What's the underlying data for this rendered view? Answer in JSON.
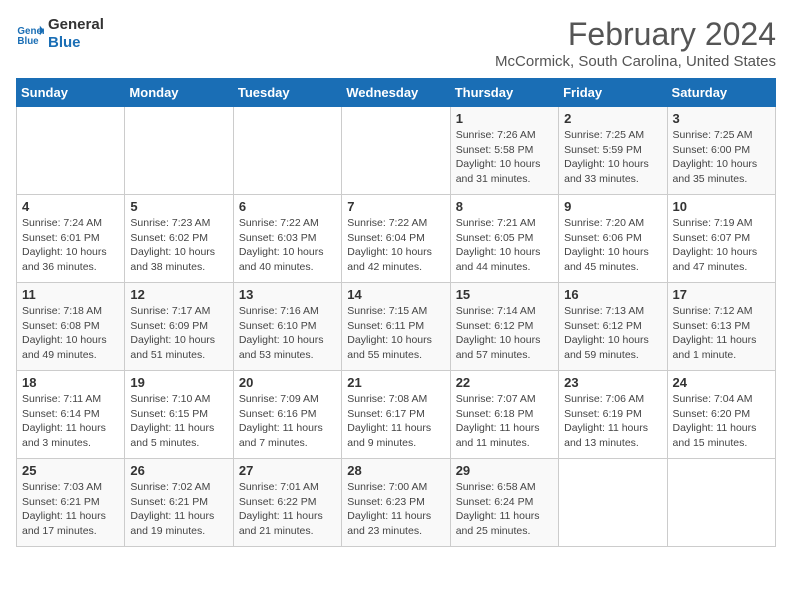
{
  "logo": {
    "line1": "General",
    "line2": "Blue"
  },
  "title": "February 2024",
  "subtitle": "McCormick, South Carolina, United States",
  "header": {
    "days": [
      "Sunday",
      "Monday",
      "Tuesday",
      "Wednesday",
      "Thursday",
      "Friday",
      "Saturday"
    ]
  },
  "weeks": [
    [
      {
        "day": "",
        "info": ""
      },
      {
        "day": "",
        "info": ""
      },
      {
        "day": "",
        "info": ""
      },
      {
        "day": "",
        "info": ""
      },
      {
        "day": "1",
        "info": "Sunrise: 7:26 AM\nSunset: 5:58 PM\nDaylight: 10 hours\nand 31 minutes."
      },
      {
        "day": "2",
        "info": "Sunrise: 7:25 AM\nSunset: 5:59 PM\nDaylight: 10 hours\nand 33 minutes."
      },
      {
        "day": "3",
        "info": "Sunrise: 7:25 AM\nSunset: 6:00 PM\nDaylight: 10 hours\nand 35 minutes."
      }
    ],
    [
      {
        "day": "4",
        "info": "Sunrise: 7:24 AM\nSunset: 6:01 PM\nDaylight: 10 hours\nand 36 minutes."
      },
      {
        "day": "5",
        "info": "Sunrise: 7:23 AM\nSunset: 6:02 PM\nDaylight: 10 hours\nand 38 minutes."
      },
      {
        "day": "6",
        "info": "Sunrise: 7:22 AM\nSunset: 6:03 PM\nDaylight: 10 hours\nand 40 minutes."
      },
      {
        "day": "7",
        "info": "Sunrise: 7:22 AM\nSunset: 6:04 PM\nDaylight: 10 hours\nand 42 minutes."
      },
      {
        "day": "8",
        "info": "Sunrise: 7:21 AM\nSunset: 6:05 PM\nDaylight: 10 hours\nand 44 minutes."
      },
      {
        "day": "9",
        "info": "Sunrise: 7:20 AM\nSunset: 6:06 PM\nDaylight: 10 hours\nand 45 minutes."
      },
      {
        "day": "10",
        "info": "Sunrise: 7:19 AM\nSunset: 6:07 PM\nDaylight: 10 hours\nand 47 minutes."
      }
    ],
    [
      {
        "day": "11",
        "info": "Sunrise: 7:18 AM\nSunset: 6:08 PM\nDaylight: 10 hours\nand 49 minutes."
      },
      {
        "day": "12",
        "info": "Sunrise: 7:17 AM\nSunset: 6:09 PM\nDaylight: 10 hours\nand 51 minutes."
      },
      {
        "day": "13",
        "info": "Sunrise: 7:16 AM\nSunset: 6:10 PM\nDaylight: 10 hours\nand 53 minutes."
      },
      {
        "day": "14",
        "info": "Sunrise: 7:15 AM\nSunset: 6:11 PM\nDaylight: 10 hours\nand 55 minutes."
      },
      {
        "day": "15",
        "info": "Sunrise: 7:14 AM\nSunset: 6:12 PM\nDaylight: 10 hours\nand 57 minutes."
      },
      {
        "day": "16",
        "info": "Sunrise: 7:13 AM\nSunset: 6:12 PM\nDaylight: 10 hours\nand 59 minutes."
      },
      {
        "day": "17",
        "info": "Sunrise: 7:12 AM\nSunset: 6:13 PM\nDaylight: 11 hours\nand 1 minute."
      }
    ],
    [
      {
        "day": "18",
        "info": "Sunrise: 7:11 AM\nSunset: 6:14 PM\nDaylight: 11 hours\nand 3 minutes."
      },
      {
        "day": "19",
        "info": "Sunrise: 7:10 AM\nSunset: 6:15 PM\nDaylight: 11 hours\nand 5 minutes."
      },
      {
        "day": "20",
        "info": "Sunrise: 7:09 AM\nSunset: 6:16 PM\nDaylight: 11 hours\nand 7 minutes."
      },
      {
        "day": "21",
        "info": "Sunrise: 7:08 AM\nSunset: 6:17 PM\nDaylight: 11 hours\nand 9 minutes."
      },
      {
        "day": "22",
        "info": "Sunrise: 7:07 AM\nSunset: 6:18 PM\nDaylight: 11 hours\nand 11 minutes."
      },
      {
        "day": "23",
        "info": "Sunrise: 7:06 AM\nSunset: 6:19 PM\nDaylight: 11 hours\nand 13 minutes."
      },
      {
        "day": "24",
        "info": "Sunrise: 7:04 AM\nSunset: 6:20 PM\nDaylight: 11 hours\nand 15 minutes."
      }
    ],
    [
      {
        "day": "25",
        "info": "Sunrise: 7:03 AM\nSunset: 6:21 PM\nDaylight: 11 hours\nand 17 minutes."
      },
      {
        "day": "26",
        "info": "Sunrise: 7:02 AM\nSunset: 6:21 PM\nDaylight: 11 hours\nand 19 minutes."
      },
      {
        "day": "27",
        "info": "Sunrise: 7:01 AM\nSunset: 6:22 PM\nDaylight: 11 hours\nand 21 minutes."
      },
      {
        "day": "28",
        "info": "Sunrise: 7:00 AM\nSunset: 6:23 PM\nDaylight: 11 hours\nand 23 minutes."
      },
      {
        "day": "29",
        "info": "Sunrise: 6:58 AM\nSunset: 6:24 PM\nDaylight: 11 hours\nand 25 minutes."
      },
      {
        "day": "",
        "info": ""
      },
      {
        "day": "",
        "info": ""
      }
    ]
  ]
}
